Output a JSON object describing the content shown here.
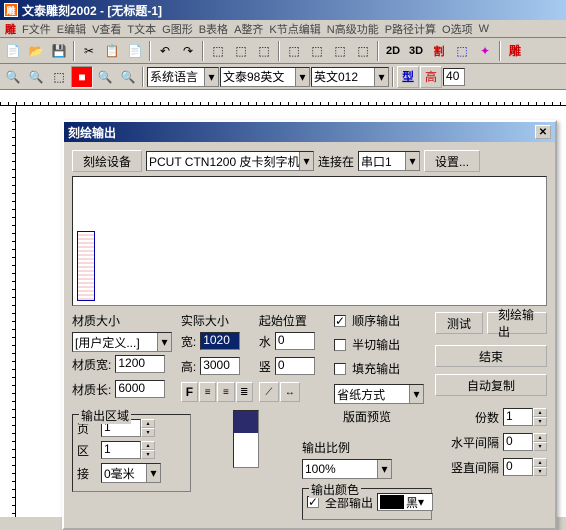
{
  "app": {
    "title": "文泰雕刻2002 - [无标题-1]",
    "icon": "雕"
  },
  "menu": [
    "雕",
    "F文件",
    "E编辑",
    "V查看",
    "T文本",
    "G图形",
    "B表格",
    "A整齐",
    "K节点编辑",
    "N高级功能",
    "P路径计算",
    "O选项",
    "W"
  ],
  "tb2": {
    "lang": "系统语言",
    "font": "文泰98英文",
    "style": "英文012",
    "btn_type": "型",
    "btn_high": "高",
    "val": "40"
  },
  "tb1": {
    "d2": "2D",
    "d3": "3D",
    "cut": "割"
  },
  "dialog": {
    "title": "刻绘输出",
    "device_btn": "刻绘设备",
    "device_val": "PCUT CTN1200 皮卡刻字机",
    "connect_lbl": "连接在",
    "connect_val": "串口1",
    "settings_btn": "设置...",
    "mat_title": "材质大小",
    "mat_sel": "[用户定义...]",
    "mat_w_lbl": "材质宽:",
    "mat_w": "1200",
    "mat_l_lbl": "材质长:",
    "mat_l": "6000",
    "real_title": "实际大小",
    "real_w_lbl": "宽:",
    "real_w": "1020",
    "real_h_lbl": "高:",
    "real_h": "3000",
    "start_title": "起始位置",
    "start_x_lbl": "水",
    "start_x": "0",
    "start_y_lbl": "竖",
    "start_y": "0",
    "chk_order": "顺序输出",
    "chk_half": "半切输出",
    "chk_fill": "填充输出",
    "paper_lbl": "省纸方式",
    "btn_test": "测试",
    "btn_output": "刻绘输出",
    "btn_end": "结束",
    "btn_copy": "自动复制",
    "area_title": "输出区域",
    "page_lbl": "页",
    "page": "1",
    "zone_lbl": "区",
    "zone": "1",
    "join_lbl": "接",
    "join": "0毫米",
    "preview_lbl": "版面预览",
    "ratio_title": "输出比例",
    "ratio": "100%",
    "color_title": "输出颜色",
    "color_all": "全部输出",
    "color_val": "黑",
    "copies_lbl": "份数",
    "copies": "1",
    "hgap_lbl": "水平间隔",
    "hgap": "0",
    "vgap_lbl": "竖直间隔",
    "vgap": "0"
  }
}
